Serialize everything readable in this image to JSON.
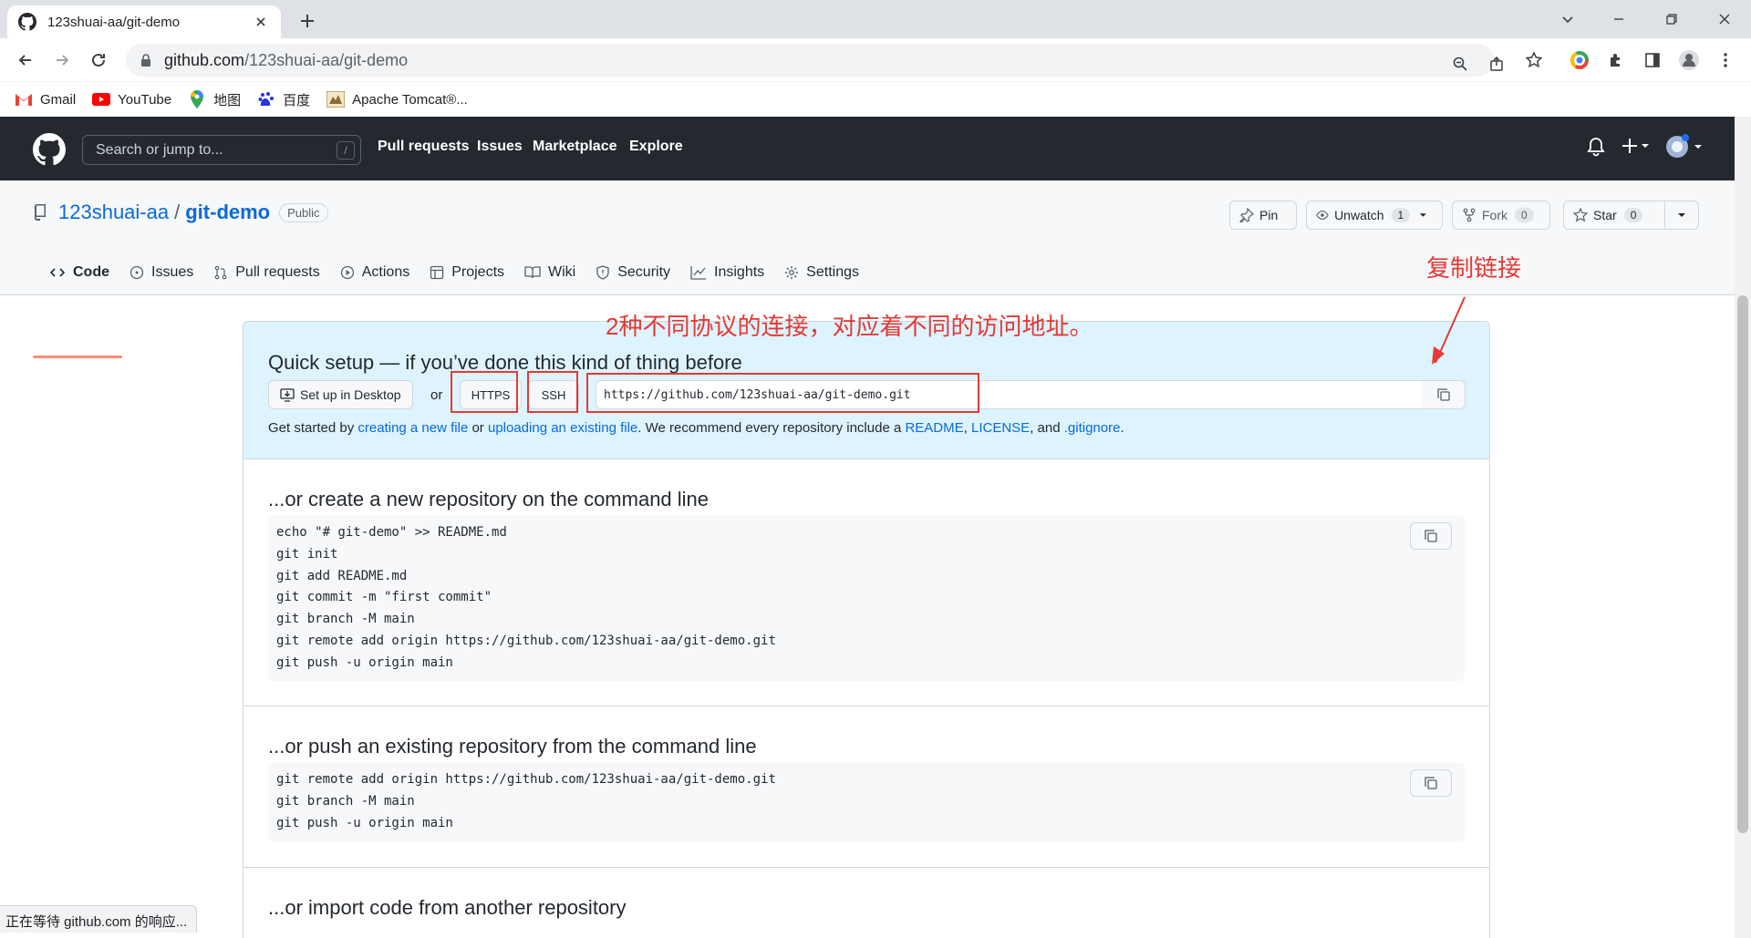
{
  "browser": {
    "tab_title": "123shuai-aa/git-demo",
    "url_host": "github.com",
    "url_path": "/123shuai-aa/git-demo",
    "bookmarks": [
      {
        "label": "Gmail",
        "icon": "gmail-icon"
      },
      {
        "label": "YouTube",
        "icon": "youtube-icon"
      },
      {
        "label": "地图",
        "icon": "maps-icon"
      },
      {
        "label": "百度",
        "icon": "baidu-icon"
      },
      {
        "label": "Apache Tomcat®...",
        "icon": "tomcat-icon"
      }
    ],
    "status_text": "正在等待 github.com 的响应..."
  },
  "github": {
    "search_placeholder": "Search or jump to...",
    "search_shortcut": "/",
    "nav": [
      "Pull requests",
      "Issues",
      "Marketplace",
      "Explore"
    ]
  },
  "repo": {
    "owner": "123shuai-aa",
    "separator": "/",
    "name": "git-demo",
    "visibility": "Public",
    "pin_label": "Pin",
    "watch_label": "Unwatch",
    "watch_count": "1",
    "fork_label": "Fork",
    "fork_count": "0",
    "star_label": "Star",
    "star_count": "0",
    "tabs": [
      "Code",
      "Issues",
      "Pull requests",
      "Actions",
      "Projects",
      "Wiki",
      "Security",
      "Insights",
      "Settings"
    ]
  },
  "quick_setup": {
    "title": "Quick setup — if you’ve done this kind of thing before",
    "desktop_button": "Set up in Desktop",
    "or": "or",
    "https": "HTTPS",
    "ssh": "SSH",
    "clone_url": "https://github.com/123shuai-aa/git-demo.git",
    "get_started_prefix": "Get started by ",
    "link_create": "creating a new file",
    "or_mid": " or ",
    "link_upload": "uploading an existing file",
    "recommend": ". We recommend every repository include a ",
    "link_readme": "README",
    "comma1": ", ",
    "link_license": "LICENSE",
    "and": ", and ",
    "link_gitignore": ".gitignore",
    "end": "."
  },
  "create_section": {
    "title": "...or create a new repository on the command line",
    "code": "echo \"# git-demo\" >> README.md\ngit init\ngit add README.md\ngit commit -m \"first commit\"\ngit branch -M main\ngit remote add origin https://github.com/123shuai-aa/git-demo.git\ngit push -u origin main"
  },
  "push_section": {
    "title": "...or push an existing repository from the command line",
    "code": "git remote add origin https://github.com/123shuai-aa/git-demo.git\ngit branch -M main\ngit push -u origin main"
  },
  "import_section": {
    "title": "...or import code from another repository"
  },
  "annotations": {
    "copy_link": "复制链接",
    "protocols_note": "2种不同协议的连接，对应着不同的访问地址。"
  },
  "colors": {
    "annotation_red": "#e53935",
    "link_blue": "#0969da",
    "header_dark": "#24292f",
    "quick_setup_bg": "#ddf4ff",
    "tab_underline": "#fd8c73"
  }
}
